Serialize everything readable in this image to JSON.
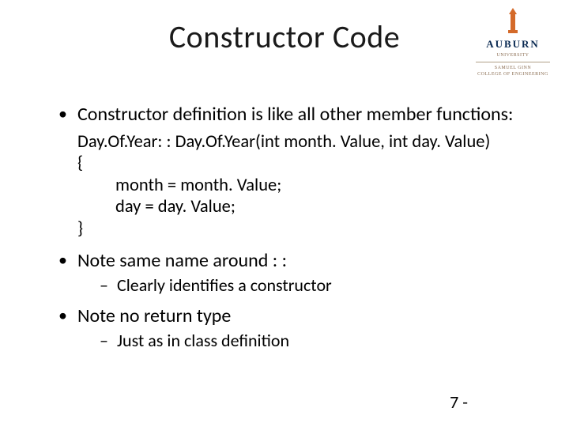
{
  "title": "Constructor Code",
  "logo": {
    "wordmark": "AUBURN",
    "sub1": "UNIVERSITY",
    "sub2": "SAMUEL GINN",
    "sub3": "COLLEGE OF ENGINEERING"
  },
  "bullets": {
    "b1": "Constructor definition is like all other member functions:",
    "code": {
      "l1": "Day.Of.Year: : Day.Of.Year(int month. Value, int day. Value)",
      "l2": "{",
      "l3": "month = month. Value;",
      "l4": "day = day. Value;",
      "l5": "}"
    },
    "b2": "Note same name around : :",
    "b2_sub": "Clearly identifies a constructor",
    "b3": "Note no return type",
    "b3_sub": "Just as in class definition"
  },
  "pagenum": "7 -"
}
